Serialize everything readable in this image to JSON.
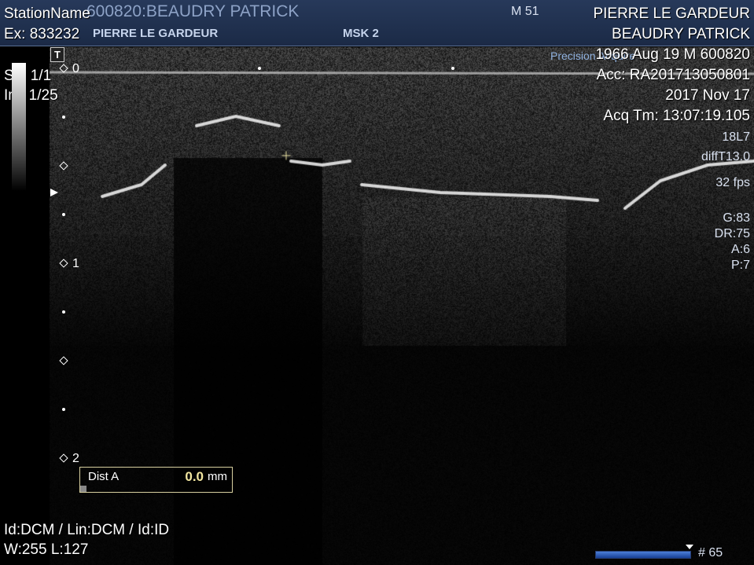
{
  "header": {
    "station": "StationName",
    "patient_banner": "600820:BEAUDRY PATRICK",
    "physician_ghost": "PIERRE LE GARDEUR",
    "study": "MSK 2",
    "mode_badge": "M 51"
  },
  "left_overlay": {
    "exam": "Ex: 833232",
    "series": "Se: 1/1",
    "image": "Im: 1/25"
  },
  "right_overlay": {
    "physician": "PIERRE LE GARDEUR",
    "patient": "BEAUDRY PATRICK",
    "dob_sex_id": "1966 Aug 19  M  600820",
    "accession": "Acc: RA201713050801",
    "date": "2017 Nov 17",
    "acq_time": "Acq Tm: 13:07:19.105",
    "probe": "18L7",
    "preset": "diffT13.0",
    "fps": "32 fps",
    "gain": "G:83",
    "dynamic_range": "DR:75",
    "a": "A:6",
    "p": "P:7",
    "ghost_logo": "Precision Acquire"
  },
  "toolbar_icon": "T",
  "depth_scale": {
    "labels": [
      "0",
      "1",
      "2"
    ]
  },
  "measurement": {
    "label": "Dist A",
    "value": "0.0",
    "unit": "mm"
  },
  "bottom_left": {
    "ids": "Id:DCM / Lin:DCM / Id:ID",
    "window_level": "W:255  L:127"
  },
  "frame_counter": "# 65",
  "colors": {
    "header_bg": "#1b2a46",
    "measure_value": "#f2e6a0",
    "scroll_bar": "#3a6cc8"
  }
}
